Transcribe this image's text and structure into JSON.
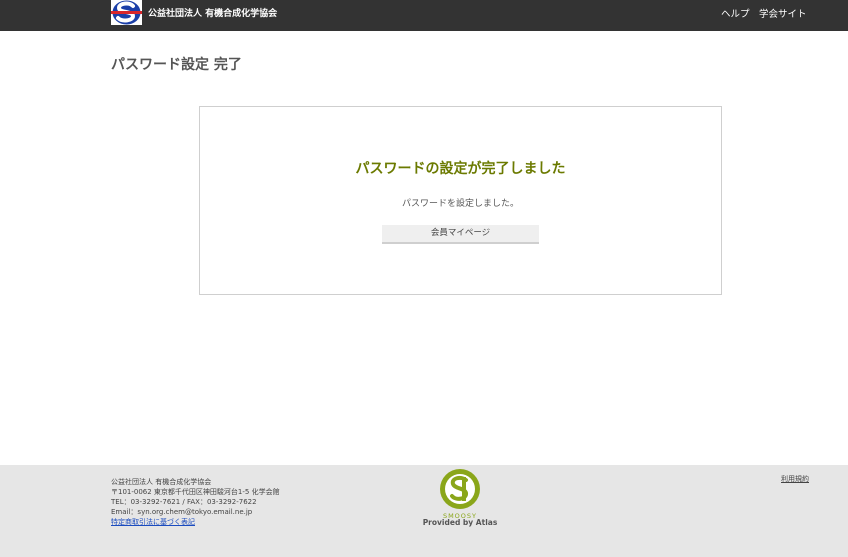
{
  "header": {
    "org_name": "公益社団法人 有機合成化学協会",
    "nav": {
      "help": "ヘルプ",
      "society_site": "学会サイト"
    }
  },
  "page": {
    "title": "パスワード設定 完了"
  },
  "card": {
    "heading": "パスワードの設定が完了しました",
    "message": "パスワードを設定しました。",
    "button_label": "会員マイページ"
  },
  "footer": {
    "org_name": "公益社団法人 有機合成化学協会",
    "address": "〒101-0062 東京都千代田区神田駿河台1-5 化学会館",
    "tel_fax": "TEL：03-3292-7621 / FAX：03-3292-7622",
    "email": "Email：syn.org.chem@tokyo.email.ne.jp",
    "commerce_link": "特定商取引法に基づく表記",
    "terms_link": "利用規約",
    "brand": "SMOOSY",
    "provided_by": "Provided by Atlas"
  },
  "colors": {
    "header_bg": "#333333",
    "heading": "#6b7a00",
    "footer_bg": "#e6e6e6",
    "brand_green": "#8aa61a"
  }
}
